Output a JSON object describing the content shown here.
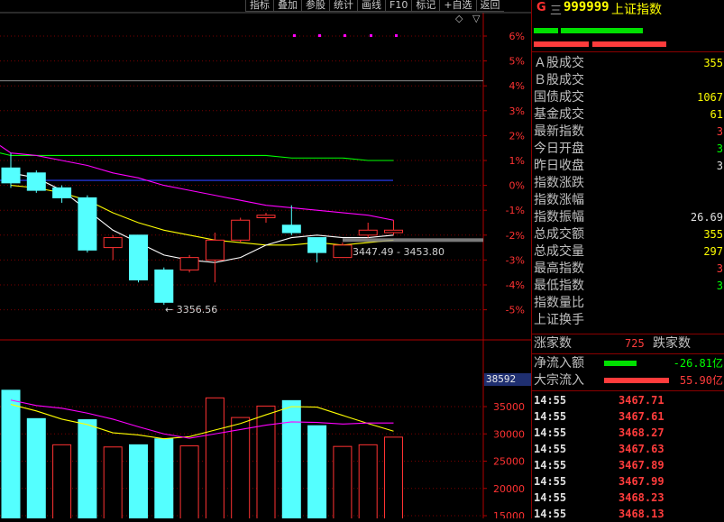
{
  "toolbar": [
    "指标",
    "叠加",
    "参股",
    "统计",
    "画线",
    "F10",
    "标记",
    "+自选",
    "返回"
  ],
  "colors": {
    "up": "#ff3232",
    "down": "#54ffff",
    "ma5": "#ffffff",
    "ma10": "#ffff00",
    "ma20": "#ff00ff",
    "ma60": "#00ff00",
    "blue": "#2a40ff",
    "yellow": "#ffff00"
  },
  "chart_data": [
    {
      "type": "candlestick",
      "y_axis_labels": [
        "6%",
        "5%",
        "4%",
        "3%",
        "2%",
        "1%",
        "0%",
        "-1%",
        "-2%",
        "-3%",
        "-4%",
        "-5%"
      ],
      "y_axis_values": [
        6,
        5,
        4,
        3,
        2,
        1,
        0,
        -1,
        -2,
        -3,
        -4,
        -5
      ],
      "ylim": [
        -5.5,
        6.6
      ],
      "candles": [
        {
          "o": 0.7,
          "c": 0.1,
          "h": 1.3,
          "l": -0.1
        },
        {
          "o": 0.5,
          "c": -0.2,
          "h": 0.6,
          "l": -0.3
        },
        {
          "o": -0.1,
          "c": -0.5,
          "h": 0.0,
          "l": -0.7
        },
        {
          "o": -0.5,
          "c": -2.6,
          "h": -0.4,
          "l": -2.7
        },
        {
          "o": -2.5,
          "c": -2.1,
          "h": -2.0,
          "l": -3.0
        },
        {
          "o": -2.0,
          "c": -3.8,
          "h": -2.0,
          "l": -3.9
        },
        {
          "o": -3.4,
          "c": -4.7,
          "h": -3.3,
          "l": -4.8
        },
        {
          "o": -3.4,
          "c": -2.9,
          "h": -2.8,
          "l": -3.5
        },
        {
          "o": -3.0,
          "c": -2.2,
          "h": -1.9,
          "l": -3.9
        },
        {
          "o": -2.2,
          "c": -1.4,
          "h": -1.3,
          "l": -2.3
        },
        {
          "o": -1.3,
          "c": -1.2,
          "h": -1.1,
          "l": -1.5
        },
        {
          "o": -1.6,
          "c": -1.9,
          "h": -0.8,
          "l": -2.0
        },
        {
          "o": -2.1,
          "c": -2.7,
          "h": -2.1,
          "l": -3.1
        },
        {
          "o": -2.9,
          "c": -2.4,
          "h": -2.3,
          "l": -2.9
        },
        {
          "o": -2.0,
          "c": -1.8,
          "h": -1.5,
          "l": -2.1
        },
        {
          "o": -1.9,
          "c": -1.8,
          "h": -1.4,
          "l": -2.0
        }
      ],
      "ma5": [
        0.5,
        0.3,
        -0.2,
        -1.0,
        -1.8,
        -2.3,
        -2.8,
        -3.0,
        -3.1,
        -2.9,
        -2.4,
        -2.1,
        -2.0,
        -2.1,
        -2.1,
        -2.0
      ],
      "ma10": [
        0.0,
        -0.1,
        -0.3,
        -0.6,
        -1.1,
        -1.5,
        -1.8,
        -2.0,
        -2.2,
        -2.3,
        -2.4,
        -2.4,
        -2.3,
        -2.4,
        -2.3,
        -2.2
      ],
      "ma20": [
        1.3,
        1.2,
        1.0,
        0.8,
        0.5,
        0.3,
        0.0,
        -0.2,
        -0.4,
        -0.6,
        -0.8,
        -0.9,
        -1.0,
        -1.1,
        -1.2,
        -1.4
      ],
      "ma60": [
        1.2,
        1.2,
        1.2,
        1.2,
        1.2,
        1.2,
        1.2,
        1.2,
        1.2,
        1.2,
        1.2,
        1.1,
        1.1,
        1.1,
        1.0,
        1.0
      ],
      "flat_line": 0.2,
      "ref_line": 4.2,
      "annotations": [
        "3356.56",
        "3447.49 - 3453.80"
      ]
    },
    {
      "type": "bar",
      "y_axis_labels": [
        "35000",
        "30000",
        "25000",
        "20000",
        "15000"
      ],
      "y_axis_values": [
        35000,
        30000,
        25000,
        20000,
        15000
      ],
      "ylim": [
        14000,
        39000
      ],
      "current_label": "38592",
      "values": [
        38000,
        32800,
        28000,
        32600,
        27600,
        28000,
        29100,
        27800,
        36600,
        33000,
        35100,
        36100,
        31500,
        27700,
        28000,
        29400
      ],
      "up": [
        false,
        false,
        true,
        false,
        true,
        false,
        false,
        true,
        true,
        true,
        true,
        false,
        false,
        true,
        true,
        true
      ],
      "ma1": [
        35400,
        34200,
        32700,
        31700,
        30200,
        29800,
        29100,
        29500,
        30700,
        31900,
        33500,
        35000,
        34900,
        33400,
        31900,
        30500
      ],
      "ma2": [
        36200,
        35200,
        34700,
        33800,
        32700,
        31300,
        30000,
        29200,
        30000,
        30800,
        31600,
        32200,
        32100,
        31800,
        32000,
        32000
      ]
    }
  ],
  "panel": {
    "g": "G",
    "eq": "三",
    "code": "999999",
    "name": "上证指数",
    "rows": [
      {
        "label": "Ａ股成交",
        "value": "355",
        "color": "#ffff00"
      },
      {
        "label": "Ｂ股成交",
        "value": "",
        "color": "#ffff00"
      },
      {
        "label": "国债成交",
        "value": "1067",
        "color": "#ffff00"
      },
      {
        "label": "基金成交",
        "value": "61",
        "color": "#ffff00"
      },
      {
        "label": "最新指数",
        "value": "3",
        "color": "#ff3c3c"
      },
      {
        "label": "今日开盘",
        "value": "3",
        "color": "#00ff00"
      },
      {
        "label": "昨日收盘",
        "value": "3",
        "color": "#e0e0e0"
      },
      {
        "label": "指数涨跌",
        "value": "",
        "color": "#e0e0e0"
      },
      {
        "label": "指数涨幅",
        "value": "",
        "color": "#e0e0e0"
      },
      {
        "label": "指数振幅",
        "value": "26.69",
        "color": "#e0e0e0"
      },
      {
        "label": "总成交额",
        "value": "355",
        "color": "#ffff00"
      },
      {
        "label": "总成交量",
        "value": "297",
        "color": "#ffff00"
      },
      {
        "label": "最高指数",
        "value": "3",
        "color": "#ff3c3c"
      },
      {
        "label": "最低指数",
        "value": "3",
        "color": "#00ff00"
      },
      {
        "label": "指数量比",
        "value": "",
        "color": "#e0e0e0"
      },
      {
        "label": "上证换手",
        "value": "",
        "color": "#e0e0e0"
      }
    ],
    "adv_label": "涨家数",
    "adv_value": "725",
    "dec_label": "跌家数",
    "net_label": "净流入额",
    "net_value": "-26.81亿",
    "block_label": "大宗流入",
    "block_value": "55.90亿",
    "ticks": [
      {
        "time": "14:55",
        "price": "3467.71"
      },
      {
        "time": "14:55",
        "price": "3467.61"
      },
      {
        "time": "14:55",
        "price": "3468.27"
      },
      {
        "time": "14:55",
        "price": "3467.63"
      },
      {
        "time": "14:55",
        "price": "3467.89"
      },
      {
        "time": "14:55",
        "price": "3467.99"
      },
      {
        "time": "14:55",
        "price": "3468.23"
      },
      {
        "time": "14:55",
        "price": "3468.13"
      }
    ]
  }
}
